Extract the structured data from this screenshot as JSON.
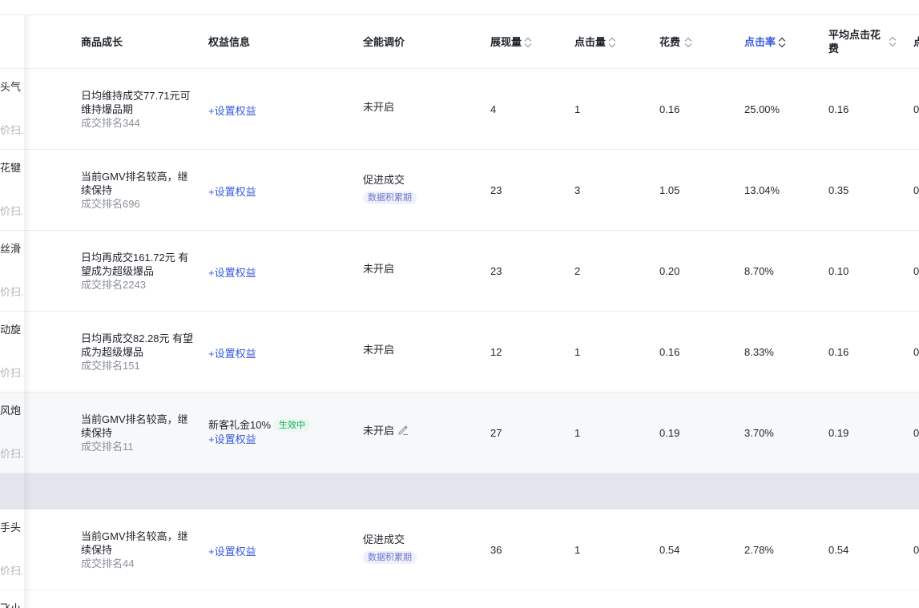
{
  "headers": {
    "growth": "商品成长",
    "rights": "权益信息",
    "pricing": "全能调价",
    "impressions": "展现量",
    "clicks": "点击量",
    "cost": "花费",
    "ctr": "点击率",
    "avg_cpc": "平均点击花费",
    "next": "点"
  },
  "set_rights_label": "+设置权益",
  "rows": [
    {
      "name_top": "头气",
      "name_bottom": "价扫...",
      "growth_main": "日均维持成交77.71元可维持爆品期",
      "growth_rank": "成交排名344",
      "rights_item": "",
      "rights_status": "",
      "pricing": "未开启",
      "pricing_badge": "",
      "impressions": "4",
      "clicks": "1",
      "cost": "0.16",
      "ctr": "25.00%",
      "avg_cpc": "0.16",
      "next": "0"
    },
    {
      "name_top": "花犍",
      "name_bottom": "价扫...",
      "growth_main": "当前GMV排名较高，继续保持",
      "growth_rank": "成交排名696",
      "rights_item": "",
      "rights_status": "",
      "pricing": "促进成交",
      "pricing_badge": "数据积累期",
      "impressions": "23",
      "clicks": "3",
      "cost": "1.05",
      "ctr": "13.04%",
      "avg_cpc": "0.35",
      "next": "0"
    },
    {
      "name_top": "丝滑",
      "name_bottom": "价扫...",
      "growth_main": "日均再成交161.72元 有望成为超级爆品",
      "growth_rank": "成交排名2243",
      "rights_item": "",
      "rights_status": "",
      "pricing": "未开启",
      "pricing_badge": "",
      "impressions": "23",
      "clicks": "2",
      "cost": "0.20",
      "ctr": "8.70%",
      "avg_cpc": "0.10",
      "next": "0"
    },
    {
      "name_top": "动旋",
      "name_bottom": "价扫...",
      "growth_main": "日均再成交82.28元 有望成为超级爆品",
      "growth_rank": "成交排名151",
      "rights_item": "",
      "rights_status": "",
      "pricing": "未开启",
      "pricing_badge": "",
      "impressions": "12",
      "clicks": "1",
      "cost": "0.16",
      "ctr": "8.33%",
      "avg_cpc": "0.16",
      "next": "0"
    },
    {
      "name_top": "风炮",
      "name_bottom": "价扫...",
      "growth_main": "当前GMV排名较高，继续保持",
      "growth_rank": "成交排名11",
      "rights_item": "新客礼金10%",
      "rights_status": "生效中",
      "pricing": "未开启",
      "pricing_badge": "",
      "impressions": "27",
      "clicks": "1",
      "cost": "0.19",
      "ctr": "3.70%",
      "avg_cpc": "0.19",
      "next": "0"
    },
    {
      "name_top": "手头",
      "name_bottom": "价扫...",
      "growth_main": "当前GMV排名较高，继续保持",
      "growth_rank": "成交排名44",
      "rights_item": "",
      "rights_status": "",
      "pricing": "促进成交",
      "pricing_badge": "数据积累期",
      "impressions": "36",
      "clicks": "1",
      "cost": "0.54",
      "ctr": "2.78%",
      "avg_cpc": "0.54",
      "next": "0"
    },
    {
      "name_top": "飞小"
    }
  ]
}
